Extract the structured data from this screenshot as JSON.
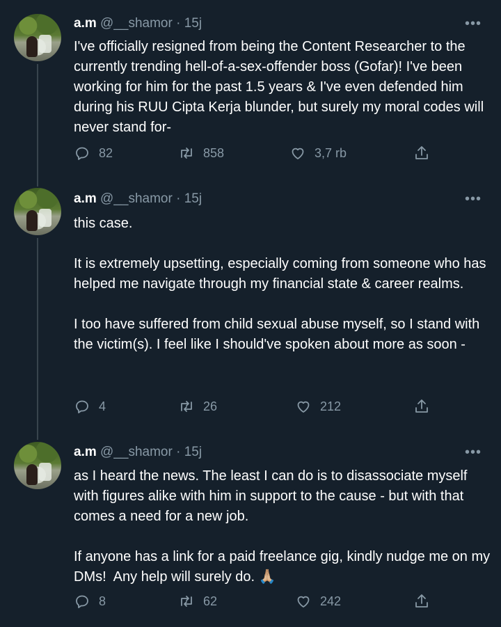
{
  "tweets": [
    {
      "name": "a.m",
      "handle": "@__shamor",
      "dot": "·",
      "time": "15j",
      "more": "•••",
      "text": "I've officially resigned from being the Content Researcher to the currently trending hell-of-a-sex-offender boss (Gofar)! I've been working for him for the past 1.5 years & I've even defended him during his RUU Cipta Kerja blunder, but surely my moral codes will never stand for-",
      "replies": "82",
      "retweets": "858",
      "likes": "3,7 rb"
    },
    {
      "name": "a.m",
      "handle": "@__shamor",
      "dot": "·",
      "time": "15j",
      "more": "•••",
      "text": "this case.\n\nIt is extremely upsetting, especially coming from someone who has helped me navigate through my financial state & career realms.\n\nI too have suffered from child sexual abuse myself, so I stand with the victim(s). I feel like I should've spoken about more as soon -",
      "replies": "4",
      "retweets": "26",
      "likes": "212"
    },
    {
      "name": "a.m",
      "handle": "@__shamor",
      "dot": "·",
      "time": "15j",
      "more": "•••",
      "text": "as I heard the news. The least I can do is to disassociate myself with figures alike with him in support to the cause - but with that comes a need for a new job.\n\nIf anyone has a link for a paid freelance gig, kindly nudge me on my DMs!  Any help will surely do.",
      "emoji": "🙏🏼",
      "replies": "8",
      "retweets": "62",
      "likes": "242"
    }
  ],
  "colors": {
    "background": "#15202b",
    "text": "#ffffff",
    "secondary": "#8899a6",
    "thread_line": "#38444d"
  },
  "icons": {
    "reply": "reply-icon",
    "retweet": "retweet-icon",
    "like": "heart-icon",
    "share": "share-icon"
  }
}
